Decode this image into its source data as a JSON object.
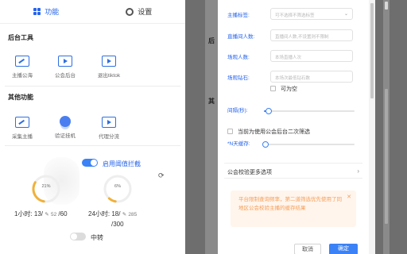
{
  "tabs": [
    {
      "label": "功能",
      "icon": "grid-icon",
      "active": true
    },
    {
      "label": "设置",
      "icon": "gear-icon",
      "active": false
    }
  ],
  "sections": {
    "backend_tools": {
      "title": "后台工具",
      "items": [
        {
          "label": "主播公海",
          "icon": "chart-icon"
        },
        {
          "label": "公会后台",
          "icon": "play-icon"
        },
        {
          "label": "退出tiktok",
          "icon": "play-icon"
        }
      ]
    },
    "other": {
      "title": "其他功能",
      "items": [
        {
          "label": "采集主播",
          "icon": "chart-icon"
        },
        {
          "label": "验证挂机",
          "icon": "person-icon"
        },
        {
          "label": "代理分流",
          "icon": "play-icon"
        }
      ]
    }
  },
  "threshold": {
    "label": "启用阈值拦截",
    "enabled": true,
    "gauge_1h": {
      "percent_label": "21%",
      "value": 21
    },
    "gauge_24h": {
      "percent_label": "6%",
      "value": 6
    }
  },
  "stats": {
    "h1": {
      "prefix": "1小时:",
      "count": "13/",
      "sub": "52",
      "limit": "/60"
    },
    "h24": {
      "prefix": "24小时:",
      "count": "18/",
      "sub": "285",
      "limit": "/300"
    }
  },
  "relay": {
    "label": "中转",
    "enabled": false
  },
  "background": {
    "label_1": "后",
    "label_2": "其"
  },
  "modal": {
    "fields": [
      {
        "label": "主播标签:",
        "placeholder": "可不选择不筛选标签",
        "type": "select"
      },
      {
        "label": "直播间人数:",
        "placeholder": "直播间人数,不设置则不限制",
        "type": "input"
      },
      {
        "label": "场观人数:",
        "placeholder": "本场直播人次",
        "type": "input"
      },
      {
        "label": "场观钻石:",
        "placeholder": "本场次最低钻石数",
        "type": "input"
      }
    ],
    "nullable_label": "可为空",
    "interval_label": "间隔(秒):",
    "interval_value": 0.05,
    "secondary_filter_label": "当前为使用公会后台二次筛选",
    "n_days_label": "*N天缓存:",
    "n_days_value": 0.02,
    "more_options_label": "公会校验更多选项",
    "notice_text": "平台限制查询频率，第二道筛选优先使用了同地区公会校验主播的缓存结果",
    "cancel_label": "取消",
    "ok_label": "确定"
  },
  "colors": {
    "accent": "#3b82f6",
    "notice": "#f59e5a",
    "overlay": "#6e6e6e"
  }
}
